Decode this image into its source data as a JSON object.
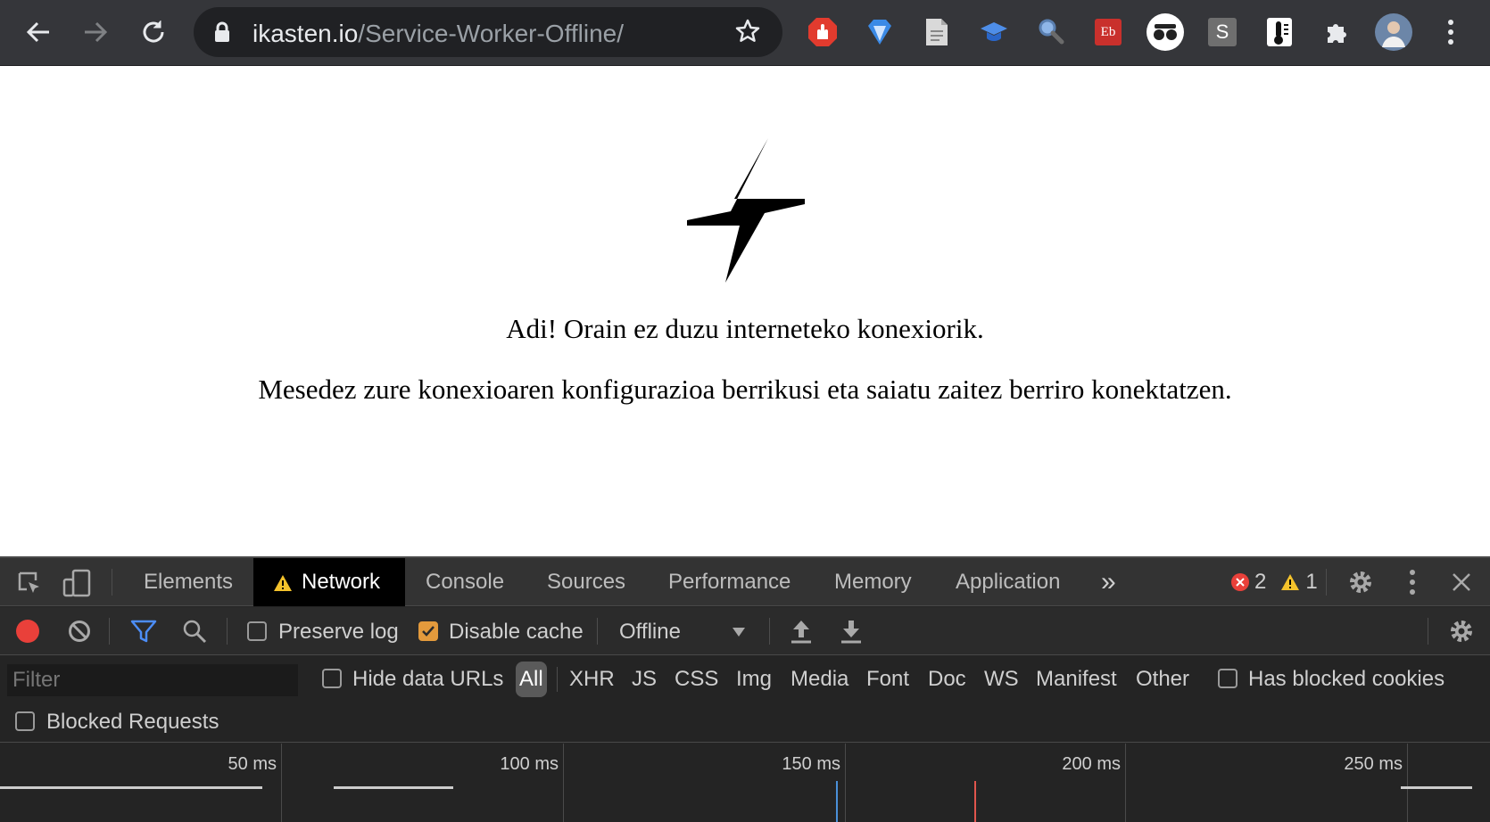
{
  "browser": {
    "url_host": "ikasten.io",
    "url_path": "/Service-Worker-Offline/",
    "extensions": [
      "ublock-icon",
      "diamond-icon",
      "document-icon",
      "graduation-cap-icon",
      "magnifier-icon",
      "eb-icon",
      "eyes-icon",
      "s-icon",
      "thermometer-icon",
      "puzzle-icon",
      "profile-avatar"
    ],
    "ext_eb_label": "Eb",
    "ext_s_label": "S"
  },
  "page": {
    "line1": "Adi! Orain ez duzu interneteko konexiorik.",
    "line2": "Mesedez zure konexioaren konfigurazioa berrikusi eta saiatu zaitez berriro konektatzen."
  },
  "devtools": {
    "tabs": [
      "Elements",
      "Network",
      "Console",
      "Sources",
      "Performance",
      "Memory",
      "Application"
    ],
    "active_tab": "Network",
    "more_tabs": "»",
    "error_count": "2",
    "warning_count": "1",
    "toolbar": {
      "preserve_log": "Preserve log",
      "preserve_log_checked": false,
      "disable_cache": "Disable cache",
      "disable_cache_checked": true,
      "throttling": "Offline"
    },
    "filter": {
      "placeholder": "Filter",
      "hide_data_urls": "Hide data URLs",
      "types": [
        "All",
        "XHR",
        "JS",
        "CSS",
        "Img",
        "Media",
        "Font",
        "Doc",
        "WS",
        "Manifest",
        "Other"
      ],
      "selected_type": "All",
      "has_blocked_cookies": "Has blocked cookies",
      "blocked_requests": "Blocked Requests"
    },
    "timeline": {
      "ticks": [
        "50 ms",
        "100 ms",
        "150 ms",
        "200 ms",
        "250 ms"
      ],
      "dom_content_loaded_color": "#4a90d9",
      "load_color": "#e0554d"
    },
    "colors": {
      "record": "#e9403a",
      "filter_icon": "#4c8df6",
      "error_badge": "#e9403a",
      "warning_badge": "#f4c22b",
      "checkbox_checked": "#e39a3c"
    }
  }
}
